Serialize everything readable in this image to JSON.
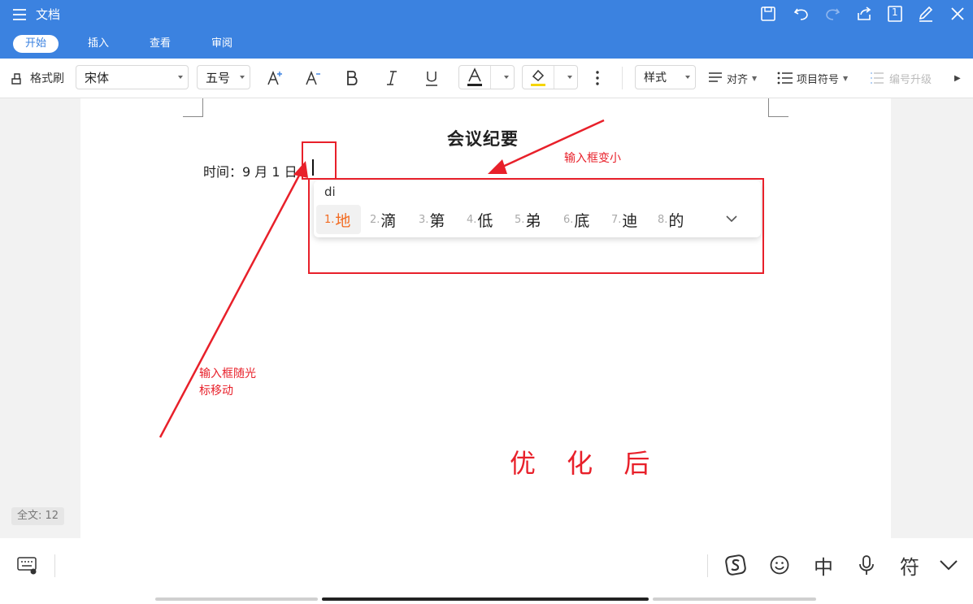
{
  "app": {
    "title": "文档"
  },
  "tabs": [
    {
      "label": "开始",
      "active": true
    },
    {
      "label": "插入",
      "active": false
    },
    {
      "label": "查看",
      "active": false
    },
    {
      "label": "审阅",
      "active": false
    }
  ],
  "titlebar_icons": [
    "save-icon",
    "undo-icon",
    "redo-icon",
    "share-icon",
    "page-count-icon",
    "edit-icon",
    "close-icon"
  ],
  "page_count_badge": "1",
  "toolbar": {
    "format_painter": "格式刷",
    "font_family": "宋体",
    "font_size": "五号",
    "style": "样式",
    "align": "对齐",
    "bullets": "项目符号",
    "numbering": "编号升级"
  },
  "document": {
    "title": "会议纪要",
    "line1": "时间：9 月 1 日"
  },
  "ime": {
    "pinyin": "di",
    "candidates": [
      {
        "num": "1.",
        "text": "地"
      },
      {
        "num": "2.",
        "text": "滴"
      },
      {
        "num": "3.",
        "text": "第"
      },
      {
        "num": "4.",
        "text": "低"
      },
      {
        "num": "5.",
        "text": "弟"
      },
      {
        "num": "6.",
        "text": "底"
      },
      {
        "num": "7.",
        "text": "迪"
      },
      {
        "num": "8.",
        "text": "的"
      }
    ]
  },
  "annotations": {
    "small_box": "输入框变小",
    "follow_cursor_line1": "输入框随光",
    "follow_cursor_line2": "标移动",
    "after": "优 化 后"
  },
  "status": {
    "word_count": "全文: 12"
  },
  "keyboard_bar": {
    "lang": "中",
    "symbols": "符"
  },
  "colors": {
    "accent": "#3b82e0",
    "annotation": "#e8202a",
    "candidate_highlight": "#f26b21"
  }
}
